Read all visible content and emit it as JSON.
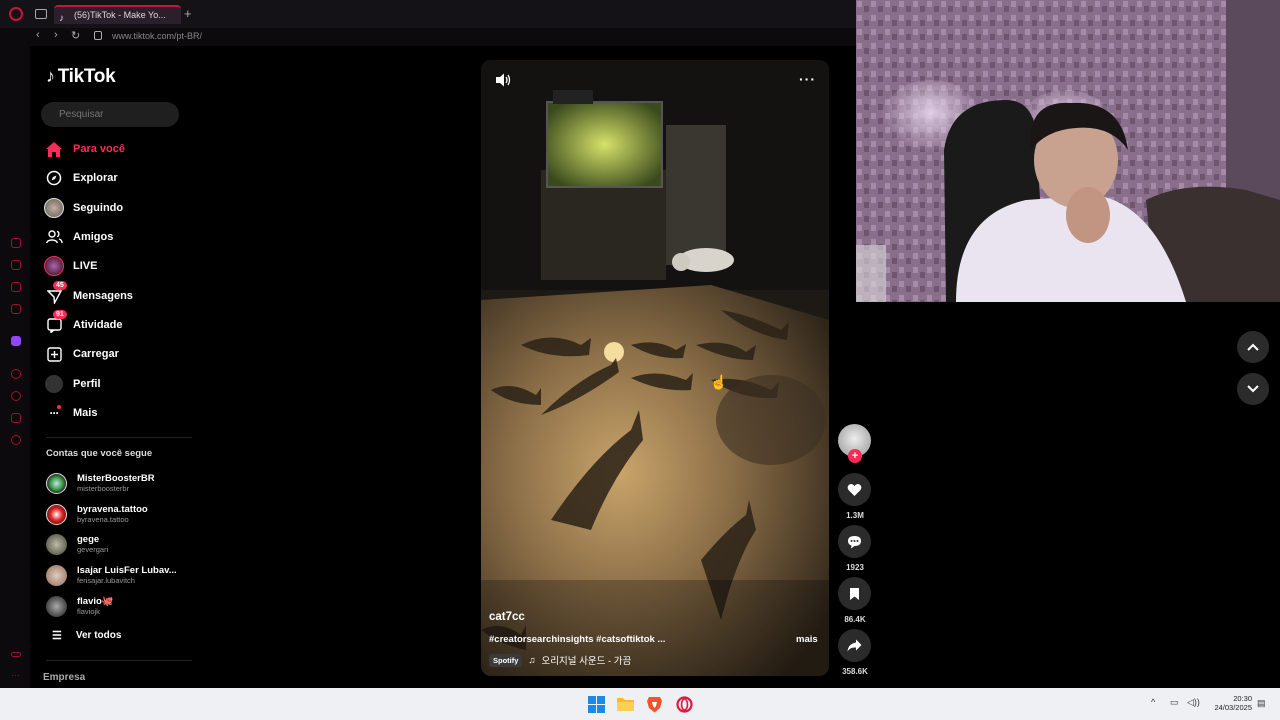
{
  "browser": {
    "tab_title": "(56)TikTok - Make Yo...",
    "url": "www.tiktok.com/pt-BR/"
  },
  "sidebar": {
    "logo": "TikTok",
    "search_placeholder": "Pesquisar",
    "nav": [
      {
        "label": "Para você",
        "icon": "home-icon",
        "active": true
      },
      {
        "label": "Explorar",
        "icon": "compass-icon"
      },
      {
        "label": "Seguindo",
        "icon": "following-avatar-icon"
      },
      {
        "label": "Amigos",
        "icon": "friends-icon"
      },
      {
        "label": "LIVE",
        "icon": "live-icon"
      },
      {
        "label": "Mensagens",
        "icon": "messages-icon",
        "badge": "45"
      },
      {
        "label": "Atividade",
        "icon": "activity-icon",
        "badge": "91"
      },
      {
        "label": "Carregar",
        "icon": "upload-icon"
      },
      {
        "label": "Perfil",
        "icon": "profile-icon"
      },
      {
        "label": "Mais",
        "icon": "more-icon"
      }
    ],
    "following_title": "Contas que você segue",
    "accounts": [
      {
        "name": "MisterBoosterBR",
        "handle": "misterboosterbr"
      },
      {
        "name": "byravena.tattoo",
        "handle": "byravena.tattoo"
      },
      {
        "name": "gege",
        "handle": "gevergari"
      },
      {
        "name": "Isajar LuisFer Lubav...",
        "handle": "ferisajar.lubavitch"
      },
      {
        "name": "flavio🐙",
        "handle": "flaviojk"
      }
    ],
    "see_all": "Ver todos",
    "business": "Empresa"
  },
  "video": {
    "author": "cat7cc",
    "caption": "#creatorsearchinsights #catsoftiktok ...",
    "more": "mais",
    "music_source": "Spotify",
    "music": "오리지널 사운드 - 가끔",
    "likes": "1.3M",
    "comments": "1923",
    "saves": "86.4K",
    "shares": "358.6K"
  },
  "taskbar": {
    "time": "20:30",
    "date": "24/03/2025"
  },
  "colors": {
    "accent": "#fe2c55",
    "opera_red": "#c4173a",
    "background": "#000000"
  }
}
